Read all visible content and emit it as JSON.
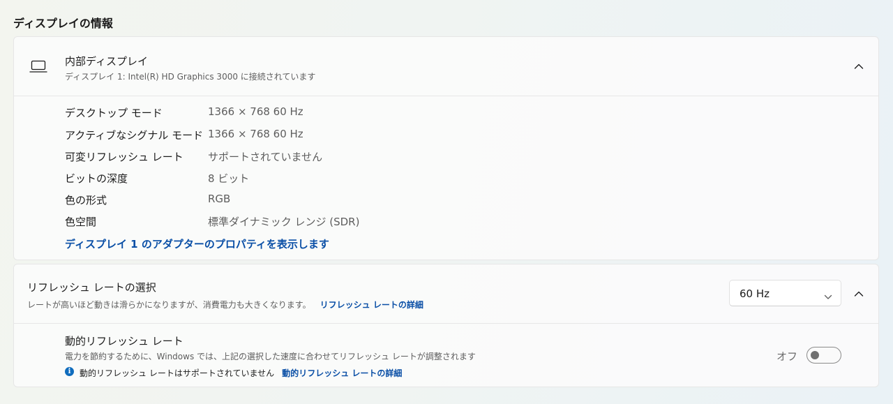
{
  "section": {
    "title": "ディスプレイの情報"
  },
  "display": {
    "title": "内部ディスプレイ",
    "subtitle": "ディスプレイ 1: Intel(R) HD Graphics 3000 に接続されています",
    "icon": "laptop-icon",
    "expanded": true,
    "properties": [
      {
        "label": "デスクトップ モード",
        "value": "1366 × 768 60 Hz"
      },
      {
        "label": "アクティブなシグナル モード",
        "value": "1366 × 768 60 Hz"
      },
      {
        "label": "可変リフレッシュ レート",
        "value": "サポートされていません"
      },
      {
        "label": "ビットの深度",
        "value": "8 ビット"
      },
      {
        "label": "色の形式",
        "value": "RGB"
      },
      {
        "label": "色空間",
        "value": "標準ダイナミック レンジ (SDR)"
      }
    ],
    "adapter_link": "ディスプレイ 1 のアダプターのプロパティを表示します"
  },
  "refresh": {
    "title": "リフレッシュ レートの選択",
    "description": "レートが高いほど動きは滑らかになりますが、消費電力も大きくなります。",
    "details_link": "リフレッシュ レートの詳細",
    "selected_rate": "60 Hz",
    "dynamic": {
      "title": "動的リフレッシュ レート",
      "description": "電力を節約するために、Windows では、上記の選択した速度に合わせてリフレッシュ レートが調整されます",
      "info_text": "動的リフレッシュ レートはサポートされていません",
      "info_link": "動的リフレッシュ レートの詳細",
      "toggle_state": "オフ",
      "toggle_on": false
    }
  },
  "colors": {
    "accent": "#0f6cbd",
    "link": "#0a4fa6"
  }
}
